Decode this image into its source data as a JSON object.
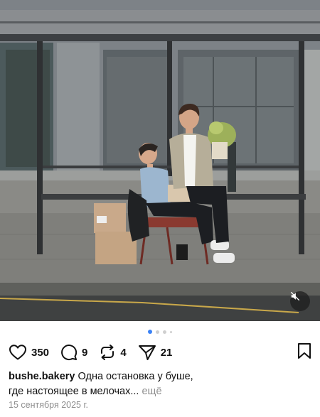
{
  "post": {
    "likes": "350",
    "comments": "9",
    "reposts": "4",
    "shares": "21",
    "username": "bushe.bakery",
    "caption_line1": "Одна остановка у буше,",
    "caption_line2": "где настоящее в мелочах...",
    "more_label": "ещё",
    "date": "15 сентября 2025 г."
  },
  "carousel": {
    "total": 4,
    "active_index": 1
  },
  "icons": {
    "like": "heart-icon",
    "comment": "comment-bubble-icon",
    "repost": "repost-arrows-icon",
    "share": "send-paper-plane-icon",
    "save": "bookmark-icon",
    "mute": "speaker-muted-icon"
  },
  "colors": {
    "accent": "#3b82f6",
    "muted_text": "#8e8e8e"
  }
}
